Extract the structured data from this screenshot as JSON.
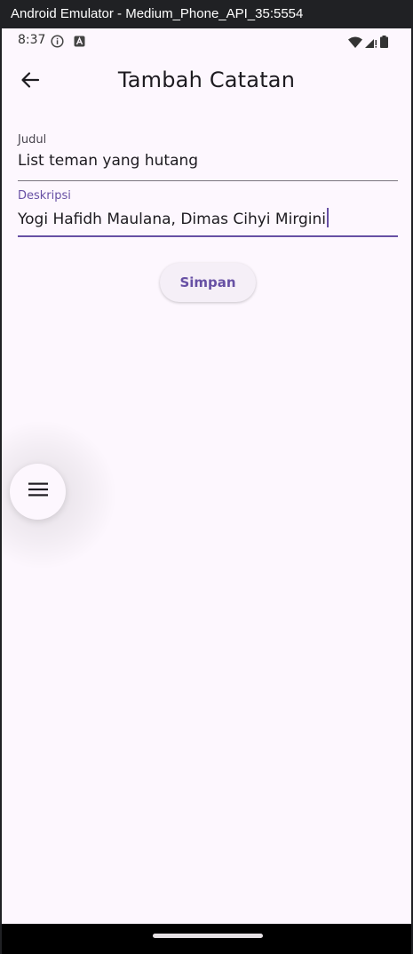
{
  "window": {
    "title": "Android Emulator - Medium_Phone_API_35:5554"
  },
  "status_bar": {
    "time": "8:37",
    "icons": [
      "info-icon",
      "a-icon",
      "wifi-icon",
      "signal-icon",
      "battery-icon"
    ]
  },
  "app_bar": {
    "back_icon": "arrow-left-icon",
    "title": "Tambah Catatan"
  },
  "form": {
    "judul": {
      "label": "Judul",
      "value": "List teman yang hutang"
    },
    "deskripsi": {
      "label": "Deskripsi",
      "value": "Yogi Hafidh Maulana, Dimas Cihyi Mirgini"
    },
    "save_label": "Simpan"
  },
  "fab": {
    "icon": "menu-icon"
  },
  "colors": {
    "background": "#fdf7fe",
    "primary": "#6750a4",
    "on_surface": "#1d1b20",
    "outline": "#79747e"
  }
}
